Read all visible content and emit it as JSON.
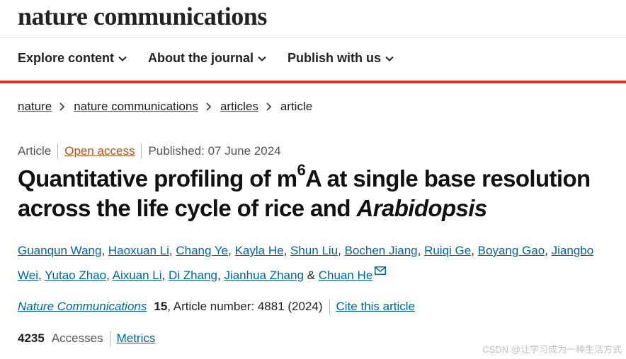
{
  "brand": "nature communications",
  "nav": [
    {
      "label": "Explore content"
    },
    {
      "label": "About the journal"
    },
    {
      "label": "Publish with us"
    }
  ],
  "breadcrumb": {
    "items": [
      "nature",
      "nature communications",
      "articles"
    ],
    "current": "article"
  },
  "meta": {
    "type": "Article",
    "access": "Open access",
    "published": "Published: 07 June 2024"
  },
  "title": {
    "part1": "Quantitative profiling of m",
    "sup": "6",
    "part2": "A at single base resolution across the life cycle of rice and ",
    "italic": "Arabidopsis"
  },
  "authors": [
    "Guanqun Wang",
    "Haoxuan Li",
    "Chang Ye",
    "Kayla He",
    "Shun Liu",
    "Bochen Jiang",
    "Ruiqi Ge",
    "Boyang Gao",
    "Jiangbo Wei",
    "Yutao Zhao",
    "Aixuan Li",
    "Di Zhang",
    "Jianhua Zhang",
    "Chuan He"
  ],
  "journal": {
    "name": "Nature Communications",
    "volume": "15",
    "details": ", Article number: 4881 (2024)",
    "cite": "Cite this article"
  },
  "metrics": {
    "count": "4235",
    "label": "Accesses",
    "link": "Metrics"
  },
  "watermark": "CSDN @让学习成为一种生活方式",
  "colors": {
    "accent_red": "#e0301e",
    "link": "#006699",
    "open_access": "#b3521c"
  },
  "icons": {
    "nav_chevron": "chevron-down-icon",
    "breadcrumb_sep": "chevron-right-icon",
    "corresponding": "mail-icon"
  }
}
